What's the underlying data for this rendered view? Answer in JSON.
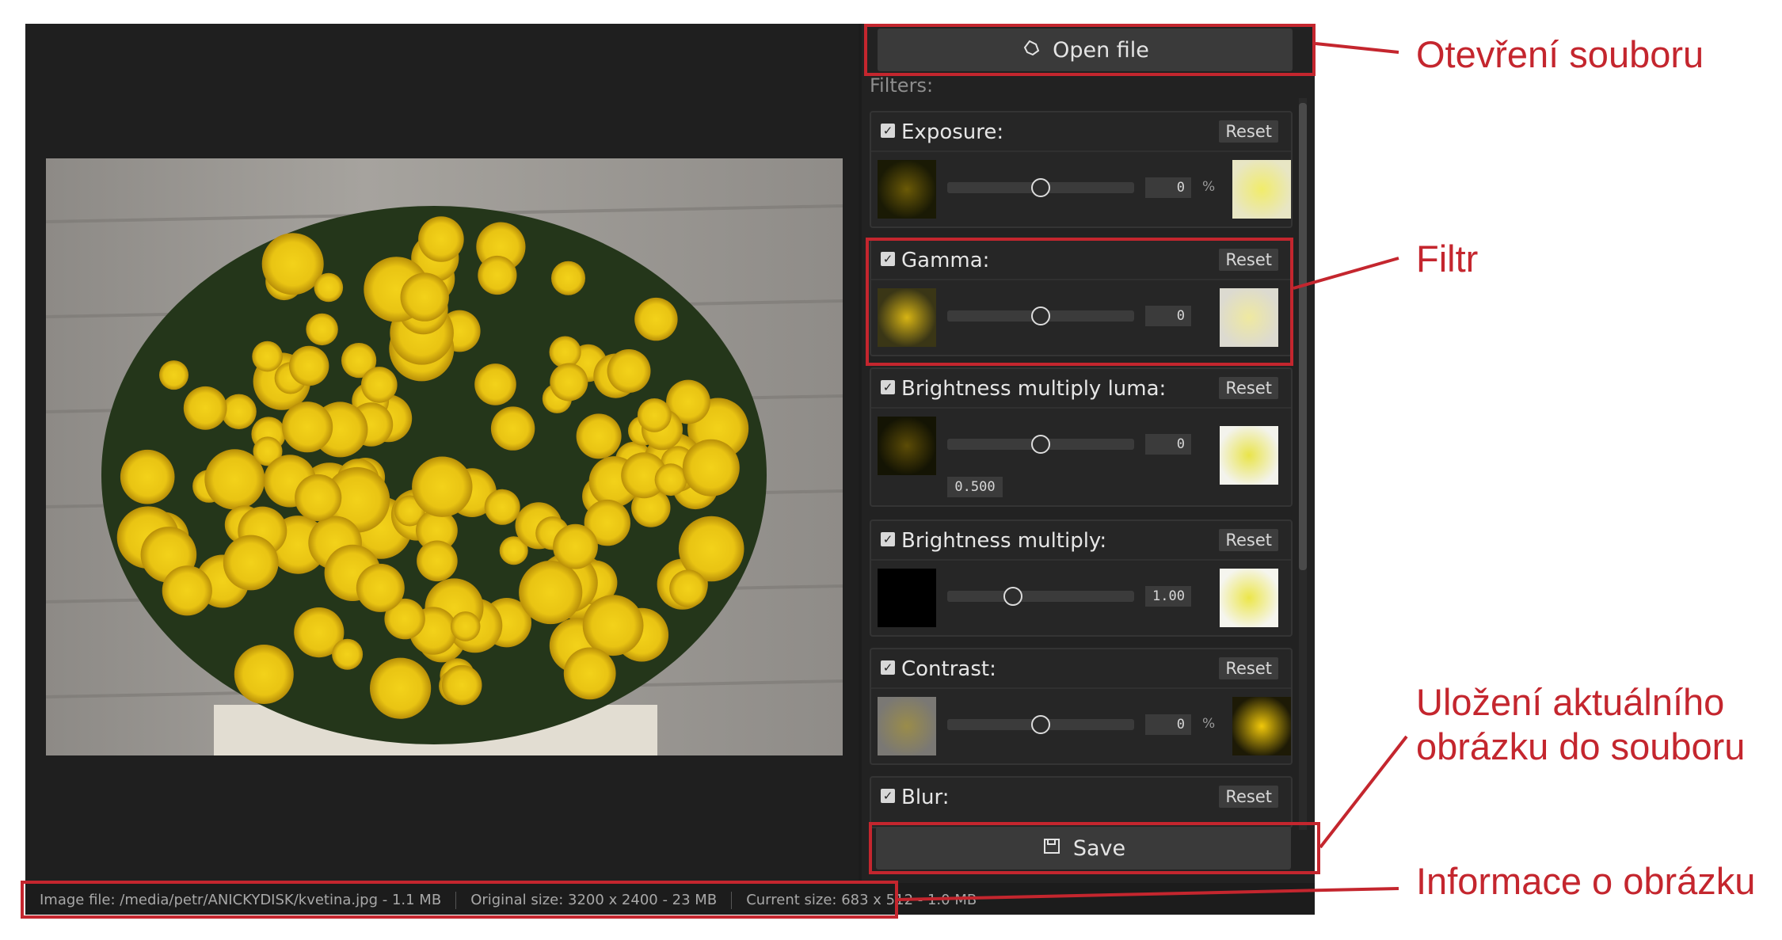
{
  "toolbar": {
    "open_label": "Open file",
    "open_icon": "hand-open-icon"
  },
  "filters_label": "Filters:",
  "filters": [
    {
      "name": "Exposure:",
      "reset": "Reset",
      "checked": true,
      "value": "0",
      "unit": "%",
      "slider_fraction": 0.5
    },
    {
      "name": "Gamma:",
      "reset": "Reset",
      "checked": true,
      "value": "0",
      "unit": "",
      "slider_fraction": 0.5
    },
    {
      "name": "Brightness multiply luma:",
      "reset": "Reset",
      "checked": true,
      "value": "0",
      "unit": "",
      "slider_fraction": 0.5,
      "secondary_value": "0.500"
    },
    {
      "name": "Brightness multiply:",
      "reset": "Reset",
      "checked": true,
      "value": "1.00",
      "unit": "",
      "slider_fraction": 0.35
    },
    {
      "name": "Contrast:",
      "reset": "Reset",
      "checked": true,
      "value": "0",
      "unit": "%",
      "slider_fraction": 0.5
    },
    {
      "name": "Blur:",
      "reset": "Reset",
      "checked": true
    }
  ],
  "save": {
    "label": "Save",
    "icon": "save-icon"
  },
  "status": {
    "image_file": "Image file: /media/petr/ANICKYDISK/kvetina.jpg - 1.1 MB",
    "original_size": "Original size: 3200 x 2400 - 23 MB",
    "current_size": "Current size: 683 x 512 - 1.0 MB"
  },
  "annotations": {
    "open": "Otevření souboru",
    "filter": "Filtr",
    "save_line1": "Uložení aktuálního",
    "save_line2": "obrázku do souboru",
    "info": "Informace o obrázku"
  },
  "colors": {
    "highlight": "#c4262e",
    "app_bg": "#1c1c1c",
    "panel_bg": "#222222"
  }
}
